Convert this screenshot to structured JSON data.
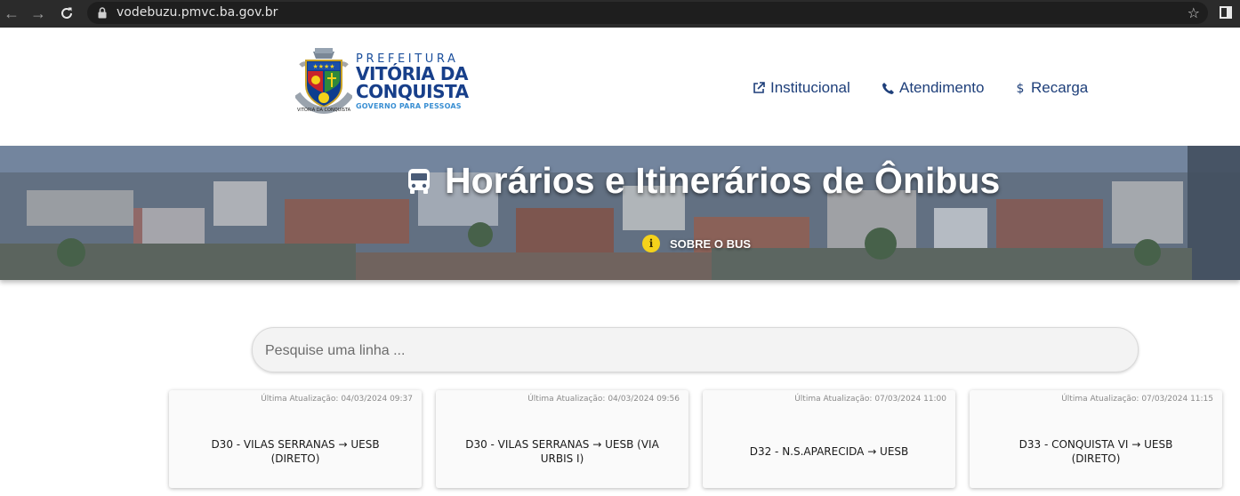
{
  "browser": {
    "url": "vodebuzu.pmvc.ba.gov.br",
    "icons": [
      "back-icon",
      "forward-icon",
      "reload-icon",
      "lock-icon",
      "star-icon",
      "side-panel-icon"
    ]
  },
  "header": {
    "logo": {
      "prefix": "PREFEITURA",
      "city_line1": "VITÓRIA DA",
      "city_line2": "CONQUISTA",
      "slogan": "GOVERNO PARA PESSOAS"
    },
    "nav": [
      {
        "label": "Institucional",
        "icon": "external-link-icon"
      },
      {
        "label": "Atendimento",
        "icon": "phone-icon"
      },
      {
        "label": "Recarga",
        "icon": "dollar-icon"
      }
    ]
  },
  "hero": {
    "title": "Horários e Itinerários de Ônibus",
    "title_icon": "bus-icon",
    "about_label": "SOBRE O BUS",
    "about_icon": "info-icon"
  },
  "search": {
    "placeholder": "Pesquise uma linha ...",
    "value": ""
  },
  "routes": [
    {
      "updated": "Última Atualização: 04/03/2024 09:37",
      "name": "D30 - VILAS SERRANAS → UESB (DIRETO)"
    },
    {
      "updated": "Última Atualização: 04/03/2024 09:56",
      "name": "D30 - VILAS SERRANAS → UESB (VIA URBIS I)"
    },
    {
      "updated": "Última Atualização: 07/03/2024 11:00",
      "name": "D32 - N.S.APARECIDA → UESB"
    },
    {
      "updated": "Última Atualização: 07/03/2024 11:15",
      "name": "D33 - CONQUISTA VI → UESB (DIRETO)"
    }
  ],
  "colors": {
    "nav_text": "#1e3f7a",
    "info_badge": "#f4d21b",
    "chrome_bg": "#2b2b2b"
  }
}
